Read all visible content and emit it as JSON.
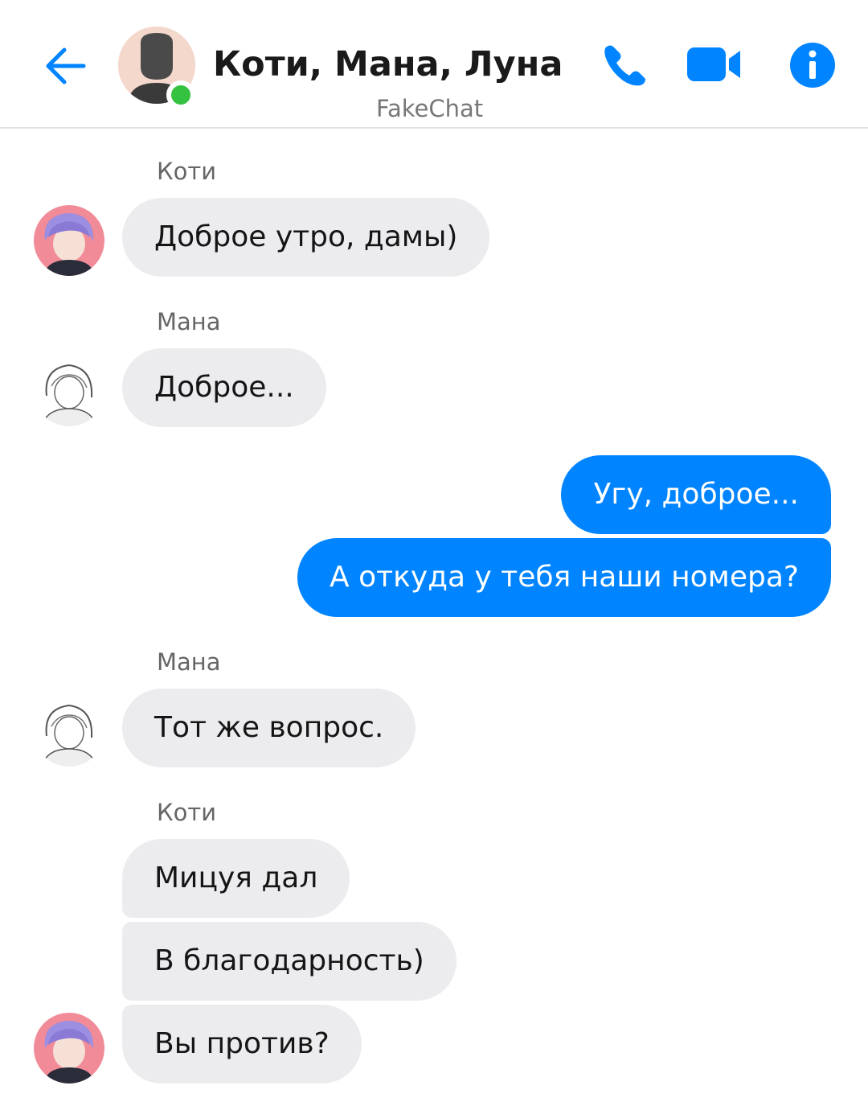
{
  "header": {
    "title": "Коти, Мана, Луна",
    "subtitle": "FakeChat",
    "back_icon": "arrow-left-icon",
    "call_icon": "phone-icon",
    "video_icon": "video-camera-icon",
    "info_icon": "info-icon",
    "accent_color": "#0084ff",
    "online_color": "#34c240"
  },
  "messages": [
    {
      "sender": "Коти",
      "text": "Доброе утро, дамы)",
      "direction": "incoming"
    },
    {
      "sender": "Мана",
      "text": "Доброе...",
      "direction": "incoming"
    },
    {
      "text": "Угу, доброе...",
      "direction": "outgoing"
    },
    {
      "text": "А откуда у тебя наши номера?",
      "direction": "outgoing"
    },
    {
      "sender": "Мана",
      "text": "Тот же вопрос.",
      "direction": "incoming"
    },
    {
      "sender": "Коти",
      "text": "Мицуя дал",
      "direction": "incoming"
    },
    {
      "text": "В благодарность)",
      "direction": "incoming"
    },
    {
      "text": "Вы против?",
      "direction": "incoming"
    }
  ],
  "colors": {
    "incoming_bubble": "#ececef",
    "outgoing_bubble": "#0084ff"
  }
}
